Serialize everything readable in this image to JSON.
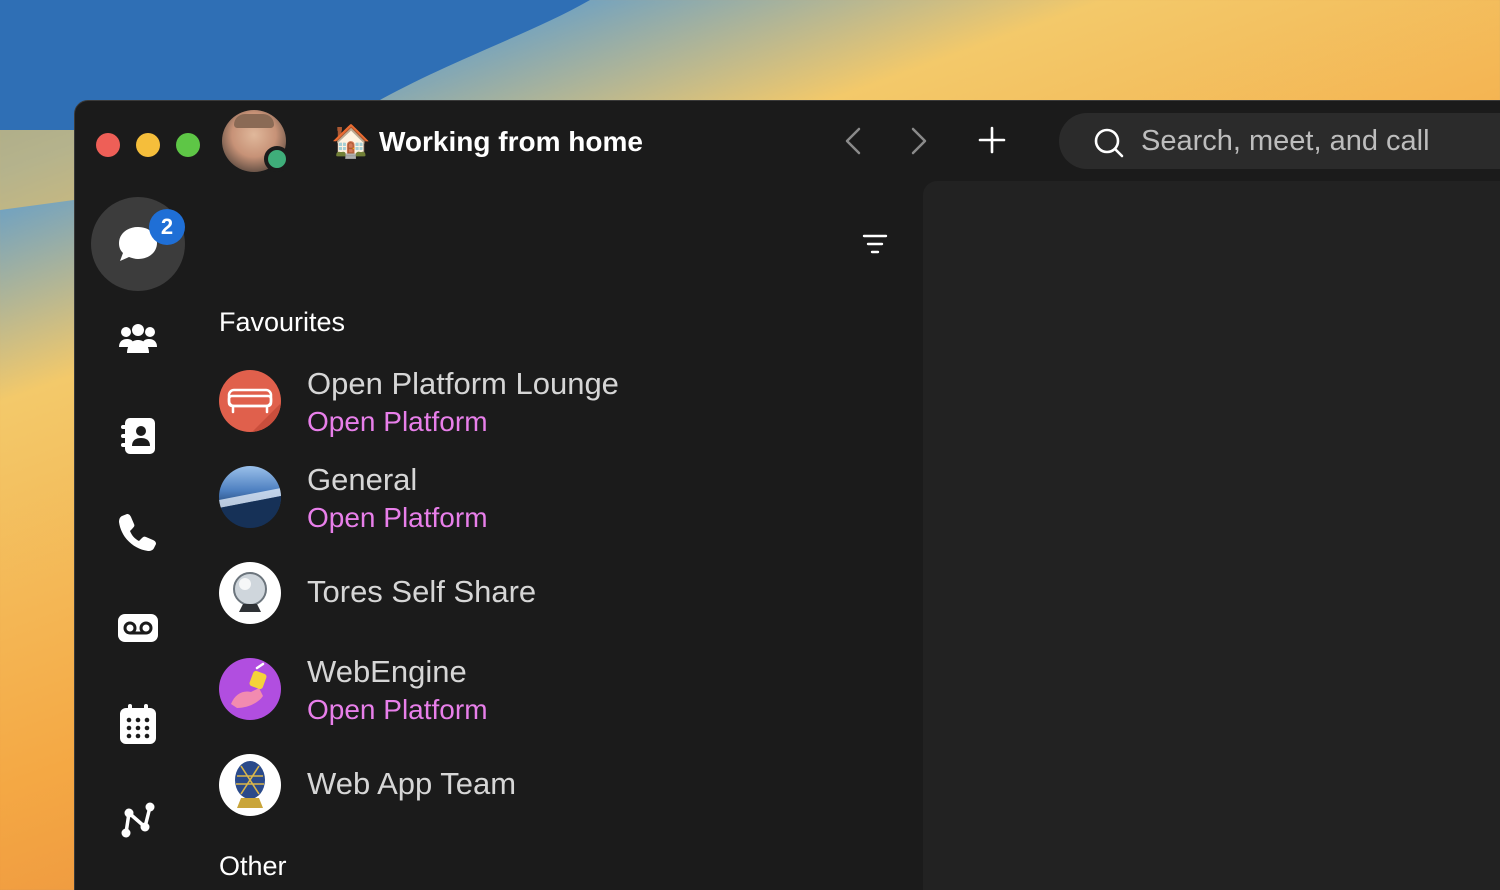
{
  "status": {
    "emoji": "🏠",
    "text": "Working from home"
  },
  "search": {
    "placeholder": "Search, meet, and call"
  },
  "rail": {
    "chat_badge": "2",
    "items": [
      "chat-icon",
      "teams-icon",
      "contacts-icon",
      "calls-icon",
      "voicemail-icon",
      "calendar-icon",
      "workflows-icon"
    ]
  },
  "list": {
    "sections": [
      {
        "title": "Favourites",
        "items": [
          {
            "name": "Open Platform Lounge",
            "subtitle": "Open Platform",
            "icon": "sofa-icon",
            "color": "#e0604c"
          },
          {
            "name": "General",
            "subtitle": "Open Platform",
            "icon": "ocean-image",
            "color": "#3b6fb0"
          },
          {
            "name": "Tores Self Share",
            "subtitle": "",
            "icon": "crystal-ball-image",
            "color": "#ffffff"
          },
          {
            "name": "WebEngine",
            "subtitle": "Open Platform",
            "icon": "unicorn-image",
            "color": "#b14ee0"
          },
          {
            "name": "Web App Team",
            "subtitle": "",
            "icon": "faberge-egg-image",
            "color": "#ffffff"
          }
        ]
      },
      {
        "title": "Other",
        "items": []
      }
    ]
  },
  "colors": {
    "accent_subtitle": "#e87fea",
    "badge": "#1f6fd6",
    "presence": "#3fae7a"
  }
}
